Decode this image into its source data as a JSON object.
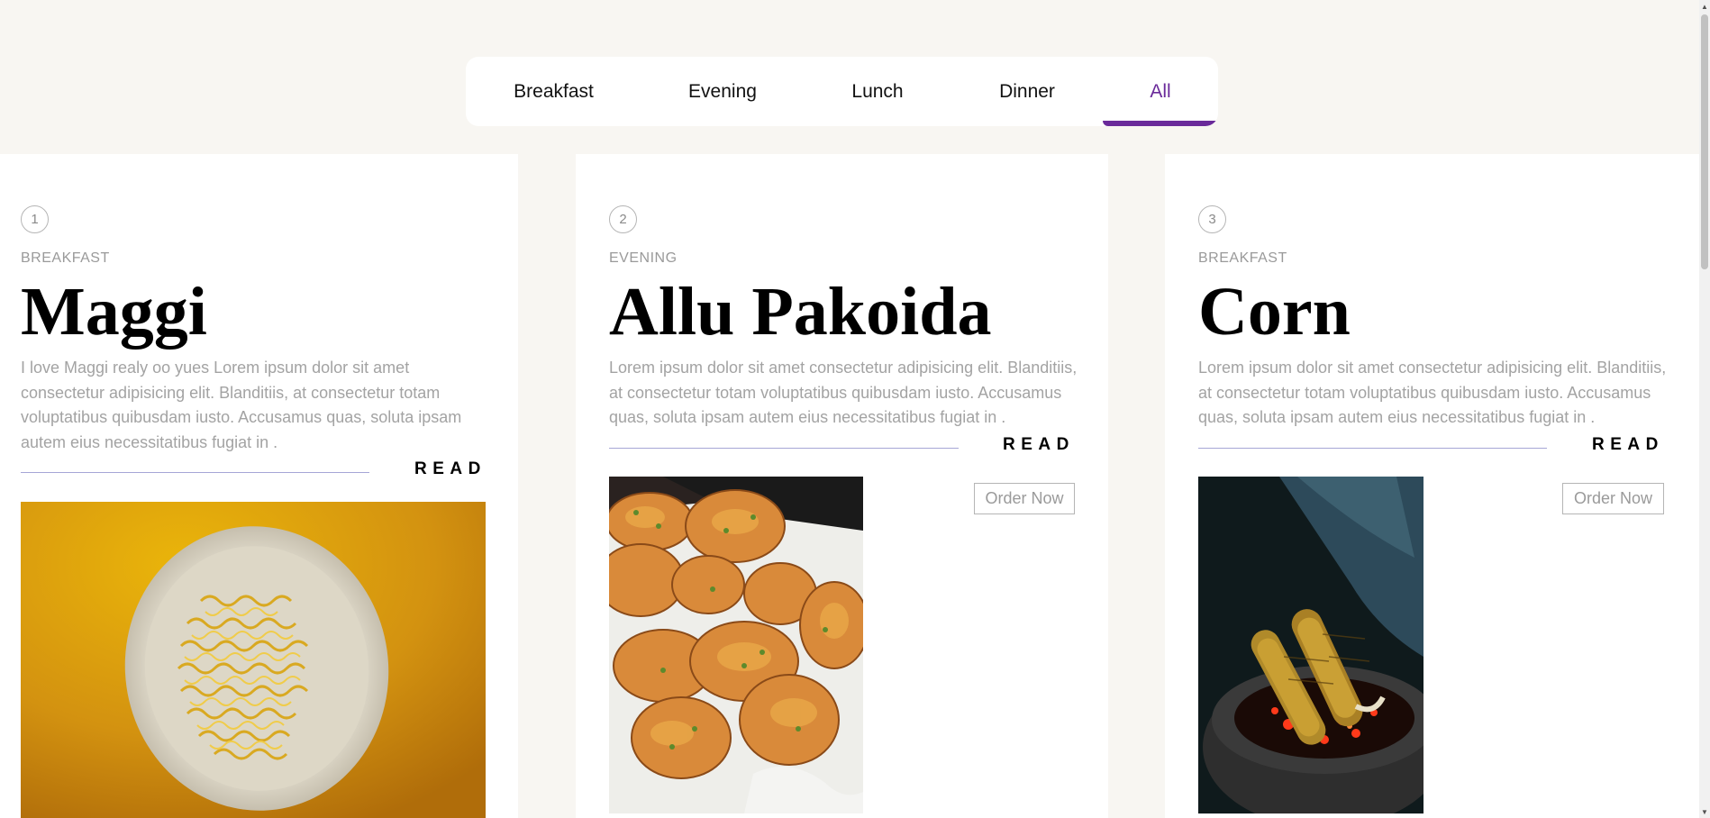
{
  "tabs": [
    {
      "label": "Breakfast"
    },
    {
      "label": "Evening"
    },
    {
      "label": "Lunch"
    },
    {
      "label": "Dinner"
    },
    {
      "label": "All",
      "active": true
    }
  ],
  "accent_color": "#6a2a9a",
  "cards": [
    {
      "number": "1",
      "category": "BREAKFAST",
      "title": "Maggi",
      "description": "I love Maggi realy oo yues Lorem ipsum dolor sit amet consectetur adipisicing elit. Blanditiis, at consectetur totam voluptatibus quibusdam iusto. Accusamus quas, soluta ipsam autem eius necessitatibus fugiat in .",
      "read_label": "READ"
    },
    {
      "number": "2",
      "category": "EVENING",
      "title": "Allu Pakoida",
      "description": "Lorem ipsum dolor sit amet consectetur adipisicing elit. Blanditiis, at consectetur totam voluptatibus quibusdam iusto. Accusamus quas, soluta ipsam autem eius necessitatibus fugiat in .",
      "read_label": "READ",
      "order_label": "Order Now"
    },
    {
      "number": "3",
      "category": "BREAKFAST",
      "title": "Corn",
      "description": "Lorem ipsum dolor sit amet consectetur adipisicing elit. Blanditiis, at consectetur totam voluptatibus quibusdam iusto. Accusamus quas, soluta ipsam autem eius necessitatibus fugiat in .",
      "read_label": "READ",
      "order_label": "Order Now"
    }
  ]
}
